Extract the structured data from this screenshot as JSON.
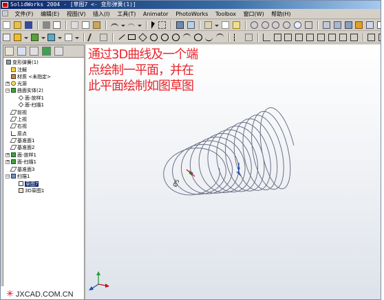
{
  "window": {
    "title": "SolidWorks 2004 - [草图7 <- 变形弹簧(1)]"
  },
  "menu": [
    "文件(F)",
    "编辑(E)",
    "视图(V)",
    "插入(I)",
    "工具(T)",
    "Animator",
    "PhotoWorks",
    "Toolbox",
    "窗口(W)",
    "帮助(H)"
  ],
  "tree": {
    "tabs": [
      "feature-manager-tab",
      "property-manager-tab",
      "configuration-manager-tab",
      "photoworks-tab",
      "animator-tab"
    ],
    "nodes": [
      {
        "label": "变形弹簧(1)",
        "icon": "part-icon"
      },
      {
        "label": "注解",
        "icon": "annotation-icon"
      },
      {
        "label": "材质 <未指定>",
        "icon": "material-icon"
      },
      {
        "label": "光源",
        "icon": "light-icon"
      },
      {
        "label": "曲面实体(2)",
        "icon": "surface-body-icon"
      },
      {
        "label": "面-放样1",
        "icon": "surface-icon"
      },
      {
        "label": "面-扫描1",
        "icon": "surface-icon"
      },
      {
        "label": "前视",
        "icon": "plane-icon"
      },
      {
        "label": "上视",
        "icon": "plane-icon"
      },
      {
        "label": "右视",
        "icon": "plane-icon"
      },
      {
        "label": "原点",
        "icon": "origin-icon"
      },
      {
        "label": "基准面1",
        "icon": "plane-icon"
      },
      {
        "label": "基准面2",
        "icon": "plane-icon"
      },
      {
        "label": "面-放样1",
        "icon": "loft-icon"
      },
      {
        "label": "面-扫描1",
        "icon": "sweep-icon"
      },
      {
        "label": "基准面3",
        "icon": "plane-icon"
      },
      {
        "label": "扫描1",
        "icon": "sweep-icon"
      },
      {
        "label": "草图7",
        "icon": "sketch-icon",
        "selected": true
      },
      {
        "label": "3D草图1",
        "icon": "3d-sketch-icon"
      }
    ]
  },
  "viewport": {
    "annotation": "通过3D曲线及一个端\n点绘制一平面，并在\n此平面绘制如图草图",
    "annotation_color": "#e8252b",
    "dimension_label": "Ø5",
    "helix_color": "#6a6f86"
  },
  "footer": {
    "site": "JXCAD.COM.CN",
    "star": "✳"
  }
}
